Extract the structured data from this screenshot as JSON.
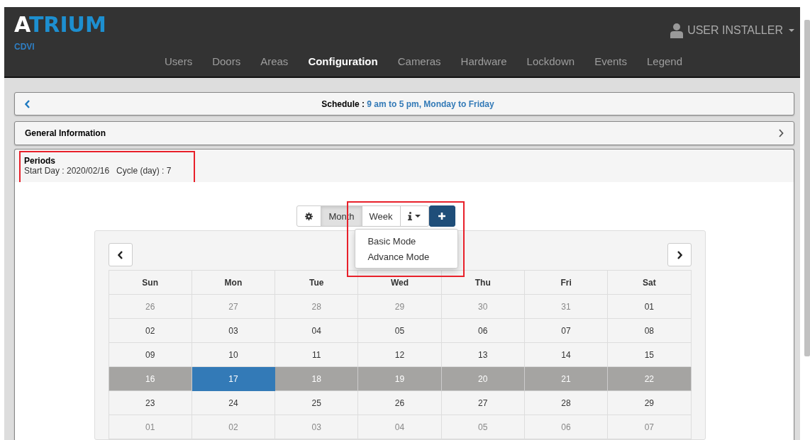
{
  "header": {
    "logo": "ATRIUM",
    "brand": "CDVI",
    "user": "USER INSTALLER",
    "nav": [
      {
        "label": "Users",
        "selected": false
      },
      {
        "label": "Doors",
        "selected": false
      },
      {
        "label": "Areas",
        "selected": false
      },
      {
        "label": "Configuration",
        "selected": true
      },
      {
        "label": "Cameras",
        "selected": false
      },
      {
        "label": "Hardware",
        "selected": false
      },
      {
        "label": "Lockdown",
        "selected": false
      },
      {
        "label": "Events",
        "selected": false
      },
      {
        "label": "Legend",
        "selected": false
      }
    ]
  },
  "schedule": {
    "label": "Schedule :",
    "name": "9 am to 5 pm, Monday to Friday"
  },
  "general": {
    "title": "General Information"
  },
  "periods": {
    "title": "Periods",
    "highlighted": true,
    "start_label": "Start Day :",
    "start": "2020/02/16",
    "cycle_label": "Cycle (day) :",
    "cycle": "7"
  },
  "toolbar": {
    "highlighted": true,
    "views": [
      {
        "label": "Month",
        "selected": true
      },
      {
        "label": "Week",
        "selected": false
      }
    ],
    "menu": [
      "Basic Mode",
      "Advance Mode"
    ]
  },
  "calendar": {
    "days": [
      "Sun",
      "Mon",
      "Tue",
      "Wed",
      "Thu",
      "Fri",
      "Sat"
    ],
    "weeks": [
      [
        {
          "text": "26",
          "kind": "outside"
        },
        {
          "text": "27",
          "kind": "outside"
        },
        {
          "text": "28",
          "kind": "outside"
        },
        {
          "text": "29",
          "kind": "outside"
        },
        {
          "text": "30",
          "kind": "outside"
        },
        {
          "text": "31",
          "kind": "outside"
        },
        {
          "text": "01",
          "kind": "normal"
        }
      ],
      [
        {
          "text": "02",
          "kind": "normal"
        },
        {
          "text": "03",
          "kind": "normal"
        },
        {
          "text": "04",
          "kind": "normal"
        },
        {
          "text": "05",
          "kind": "normal"
        },
        {
          "text": "06",
          "kind": "normal"
        },
        {
          "text": "07",
          "kind": "normal"
        },
        {
          "text": "08",
          "kind": "normal"
        }
      ],
      [
        {
          "text": "09",
          "kind": "normal"
        },
        {
          "text": "10",
          "kind": "normal"
        },
        {
          "text": "11",
          "kind": "normal"
        },
        {
          "text": "12",
          "kind": "normal"
        },
        {
          "text": "13",
          "kind": "normal"
        },
        {
          "text": "14",
          "kind": "normal"
        },
        {
          "text": "15",
          "kind": "normal"
        }
      ],
      [
        {
          "text": "16",
          "kind": "period"
        },
        {
          "text": "17",
          "kind": "today"
        },
        {
          "text": "18",
          "kind": "period"
        },
        {
          "text": "19",
          "kind": "period"
        },
        {
          "text": "20",
          "kind": "period"
        },
        {
          "text": "21",
          "kind": "period"
        },
        {
          "text": "22",
          "kind": "period"
        }
      ],
      [
        {
          "text": "23",
          "kind": "normal"
        },
        {
          "text": "24",
          "kind": "normal"
        },
        {
          "text": "25",
          "kind": "normal"
        },
        {
          "text": "26",
          "kind": "normal"
        },
        {
          "text": "27",
          "kind": "normal"
        },
        {
          "text": "28",
          "kind": "normal"
        },
        {
          "text": "29",
          "kind": "normal"
        }
      ],
      [
        {
          "text": "01",
          "kind": "outside"
        },
        {
          "text": "02",
          "kind": "outside"
        },
        {
          "text": "03",
          "kind": "outside"
        },
        {
          "text": "04",
          "kind": "outside"
        },
        {
          "text": "05",
          "kind": "outside"
        },
        {
          "text": "06",
          "kind": "outside"
        },
        {
          "text": "07",
          "kind": "outside"
        }
      ]
    ]
  }
}
